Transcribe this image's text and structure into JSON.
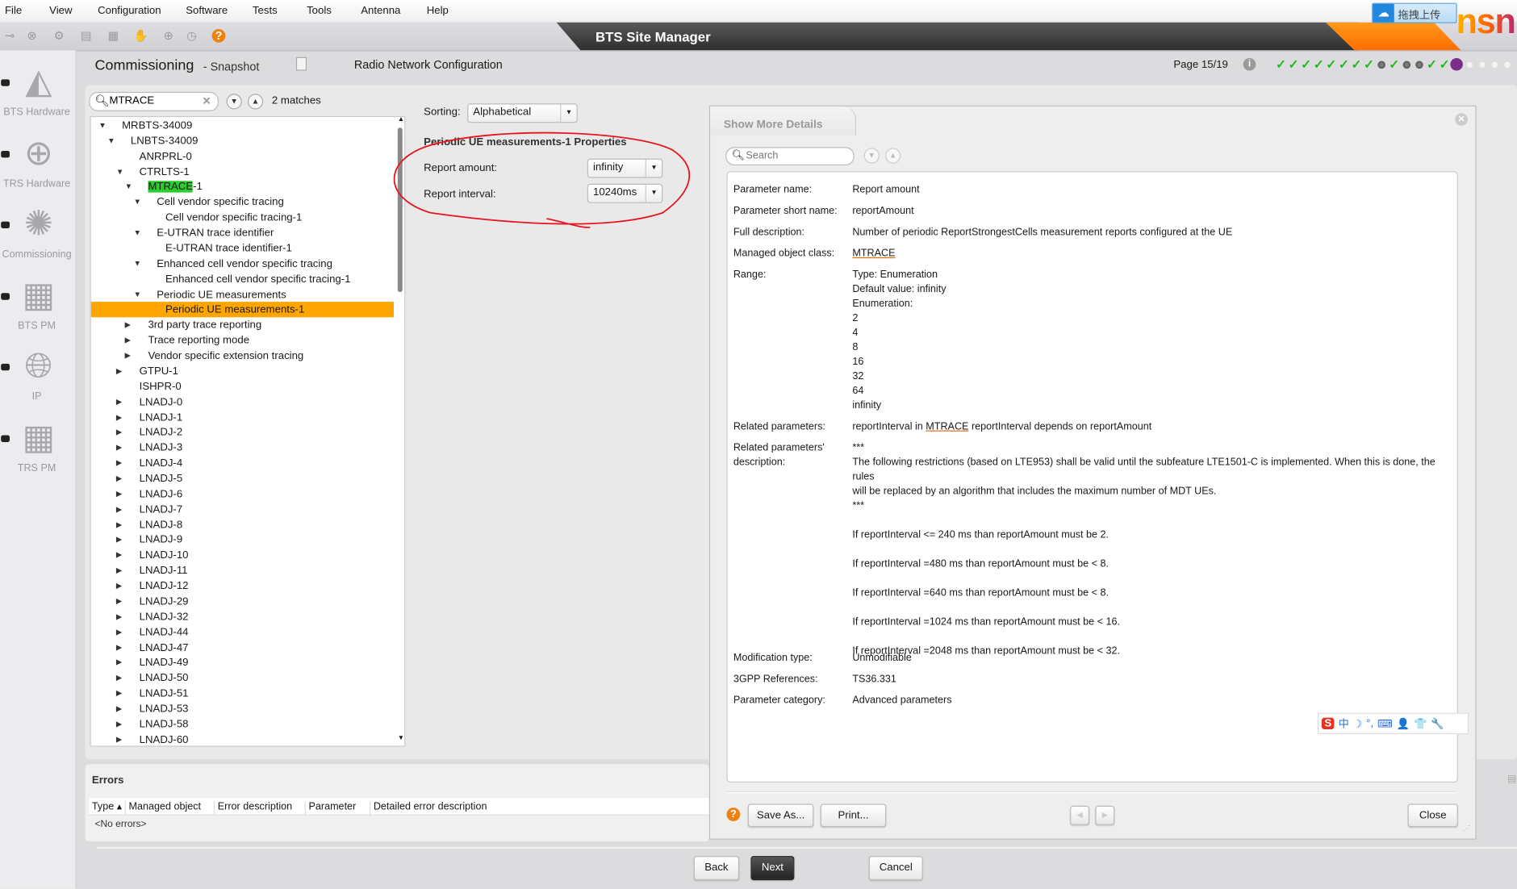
{
  "menu": [
    "File",
    "View",
    "Configuration",
    "Software",
    "Tests",
    "Tools",
    "Antenna",
    "Help"
  ],
  "toolbar": {
    "icons": [
      "connect-icon",
      "disconnect-icon",
      "settings-info-icon",
      "commission-icon",
      "report-icon",
      "reset-icon",
      "site-info-icon",
      "history-icon"
    ],
    "help_icon": "help-icon"
  },
  "app_title": "BTS Site Manager",
  "logo_text": "nsn",
  "upload_button": "拖拽上传",
  "sidebar": [
    {
      "label": "BTS Hardware",
      "icon": "bts-hardware-icon"
    },
    {
      "label": "TRS Hardware",
      "icon": "trs-hardware-icon"
    },
    {
      "label": "Commissioning",
      "icon": "commissioning-icon"
    },
    {
      "label": "BTS PM",
      "icon": "bts-pm-icon"
    },
    {
      "label": "IP",
      "icon": "ip-icon"
    },
    {
      "label": "TRS PM",
      "icon": "trs-pm-icon"
    }
  ],
  "header": {
    "title": "Commissioning",
    "subtitle": "- Snapshot",
    "section": "Radio Network Configuration",
    "page": "Page 15/19",
    "steps": [
      "done",
      "done",
      "done",
      "done",
      "done",
      "done",
      "done",
      "done",
      "skip",
      "done",
      "skip",
      "skip",
      "done",
      "done",
      "current",
      "todo",
      "todo",
      "todo",
      "todo"
    ]
  },
  "search": {
    "value": "MTRACE",
    "matches": "2 matches"
  },
  "tree": [
    {
      "label": "MRBTS-34009",
      "level": 0,
      "toggle": "expanded"
    },
    {
      "label": "LNBTS-34009",
      "level": 1,
      "toggle": "expanded"
    },
    {
      "label": "ANRPRL-0",
      "level": 2,
      "toggle": "none"
    },
    {
      "label": "CTRLTS-1",
      "level": 2,
      "toggle": "expanded"
    },
    {
      "label": "-1",
      "match": "MTRACE",
      "level": 3,
      "toggle": "expanded"
    },
    {
      "label": "Cell vendor specific tracing",
      "level": 4,
      "toggle": "expanded"
    },
    {
      "label": "Cell vendor specific tracing-1",
      "level": 5,
      "toggle": "none"
    },
    {
      "label": "E-UTRAN trace identifier",
      "level": 4,
      "toggle": "expanded"
    },
    {
      "label": "E-UTRAN trace identifier-1",
      "level": 5,
      "toggle": "none"
    },
    {
      "label": "Enhanced cell vendor specific tracing",
      "level": 4,
      "toggle": "expanded"
    },
    {
      "label": "Enhanced cell vendor specific tracing-1",
      "level": 5,
      "toggle": "none"
    },
    {
      "label": "Periodic UE measurements",
      "level": 4,
      "toggle": "expanded"
    },
    {
      "label": "Periodic UE measurements-1",
      "level": 5,
      "toggle": "none",
      "selected": true
    },
    {
      "label": "3rd party trace reporting",
      "level": 3,
      "toggle": "collapsed"
    },
    {
      "label": "Trace reporting mode",
      "level": 3,
      "toggle": "collapsed"
    },
    {
      "label": "Vendor specific extension tracing",
      "level": 3,
      "toggle": "collapsed"
    },
    {
      "label": "GTPU-1",
      "level": 2,
      "toggle": "collapsed"
    },
    {
      "label": "ISHPR-0",
      "level": 2,
      "toggle": "none"
    },
    {
      "label": "LNADJ-0",
      "level": 2,
      "toggle": "collapsed"
    },
    {
      "label": "LNADJ-1",
      "level": 2,
      "toggle": "collapsed"
    },
    {
      "label": "LNADJ-2",
      "level": 2,
      "toggle": "collapsed"
    },
    {
      "label": "LNADJ-3",
      "level": 2,
      "toggle": "collapsed"
    },
    {
      "label": "LNADJ-4",
      "level": 2,
      "toggle": "collapsed"
    },
    {
      "label": "LNADJ-5",
      "level": 2,
      "toggle": "collapsed"
    },
    {
      "label": "LNADJ-6",
      "level": 2,
      "toggle": "collapsed"
    },
    {
      "label": "LNADJ-7",
      "level": 2,
      "toggle": "collapsed"
    },
    {
      "label": "LNADJ-8",
      "level": 2,
      "toggle": "collapsed"
    },
    {
      "label": "LNADJ-9",
      "level": 2,
      "toggle": "collapsed"
    },
    {
      "label": "LNADJ-10",
      "level": 2,
      "toggle": "collapsed"
    },
    {
      "label": "LNADJ-11",
      "level": 2,
      "toggle": "collapsed"
    },
    {
      "label": "LNADJ-12",
      "level": 2,
      "toggle": "collapsed"
    },
    {
      "label": "LNADJ-29",
      "level": 2,
      "toggle": "collapsed"
    },
    {
      "label": "LNADJ-32",
      "level": 2,
      "toggle": "collapsed"
    },
    {
      "label": "LNADJ-44",
      "level": 2,
      "toggle": "collapsed"
    },
    {
      "label": "LNADJ-47",
      "level": 2,
      "toggle": "collapsed"
    },
    {
      "label": "LNADJ-49",
      "level": 2,
      "toggle": "collapsed"
    },
    {
      "label": "LNADJ-50",
      "level": 2,
      "toggle": "collapsed"
    },
    {
      "label": "LNADJ-51",
      "level": 2,
      "toggle": "collapsed"
    },
    {
      "label": "LNADJ-53",
      "level": 2,
      "toggle": "collapsed"
    },
    {
      "label": "LNADJ-58",
      "level": 2,
      "toggle": "collapsed"
    },
    {
      "label": "LNADJ-60",
      "level": 2,
      "toggle": "collapsed"
    }
  ],
  "sorting": {
    "label": "Sorting:",
    "value": "Alphabetical"
  },
  "properties": {
    "title": "Periodic UE measurements-1 Properties",
    "fields": [
      {
        "label": "Report amount:",
        "value": "infinity"
      },
      {
        "label": "Report interval:",
        "value": "10240ms"
      }
    ],
    "annotation_color": "#e8141e"
  },
  "dialog": {
    "title": "Show More Details",
    "search_placeholder": "Search",
    "rows": [
      {
        "label": "Parameter name:",
        "lines": [
          "Report amount"
        ]
      },
      {
        "label": "Parameter short name:",
        "lines": [
          "reportAmount"
        ]
      },
      {
        "label": "Full description:",
        "lines": [
          "Number of periodic ReportStrongestCells measurement reports configured at the UE"
        ]
      },
      {
        "label": "Managed object class:",
        "lines": [
          {
            "pre": "",
            "link": "MTRACE",
            "post": ""
          }
        ]
      },
      {
        "label": "Range:",
        "lines": [
          "Type: Enumeration",
          "Default value: infinity",
          "Enumeration:",
          "2",
          "4",
          "8",
          "16",
          "32",
          "64",
          "infinity"
        ]
      },
      {
        "label": "Related parameters:",
        "lines": [
          {
            "pre": "reportInterval in ",
            "link": "MTRACE",
            "post": " reportInterval depends on reportAmount"
          }
        ]
      },
      {
        "label": "Related parameters' description:",
        "lines": [
          "***",
          "The following restrictions (based on LTE953) shall be valid until the subfeature LTE1501-C is implemented. When this is done, the rules",
          "will be replaced by an algorithm that includes the maximum number of MDT UEs.",
          "***",
          "",
          "If reportInterval <= 240 ms than reportAmount must be 2.",
          "",
          "If reportInterval =480 ms than reportAmount must be < 8.",
          "",
          "If reportInterval =640 ms than reportAmount must be < 8.",
          "",
          "If reportInterval =1024 ms than reportAmount must be < 16.",
          "",
          "If reportInterval =2048 ms than reportAmount must be < 32."
        ]
      },
      {
        "label": "Modification type:",
        "lines": [
          "Unmodifiable"
        ]
      },
      {
        "label": "3GPP References:",
        "lines": [
          "TS36.331"
        ]
      },
      {
        "label": "Parameter category:",
        "lines": [
          "Advanced parameters"
        ]
      }
    ],
    "buttons": {
      "save_as": "Save As...",
      "print": "Print...",
      "close": "Close"
    }
  },
  "ime_toolbar": [
    "S",
    "中",
    "☽",
    "°,",
    "⌨",
    "👤",
    "👕",
    "🔧"
  ],
  "errors": {
    "title": "Errors",
    "columns": [
      "Type ▴",
      "Managed object",
      "Error description",
      "Parameter",
      "Detailed error description"
    ],
    "empty": "<No errors>"
  },
  "nav": {
    "back": "Back",
    "next": "Next",
    "cancel": "Cancel"
  }
}
